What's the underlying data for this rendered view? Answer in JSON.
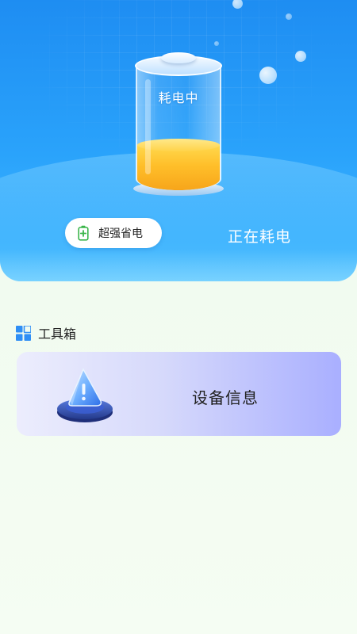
{
  "hero": {
    "battery": {
      "status_label": "耗电中",
      "fill_level": 0.36,
      "fill_color": "#ffc12e"
    },
    "mode_button": {
      "label": "超强省电",
      "icon": "battery-charge-icon"
    },
    "status_text": "正在耗电"
  },
  "toolbox": {
    "title": "工具箱",
    "title_icon": "grid-icon",
    "items": [
      {
        "label": "设备信息",
        "icon": "warning-triangle-icon"
      }
    ]
  },
  "colors": {
    "hero_blue": "#2aa3fb",
    "battery_fill": "#ffc12e",
    "card_gradient_end": "#a9afff",
    "accent_green": "#3bb54a"
  }
}
